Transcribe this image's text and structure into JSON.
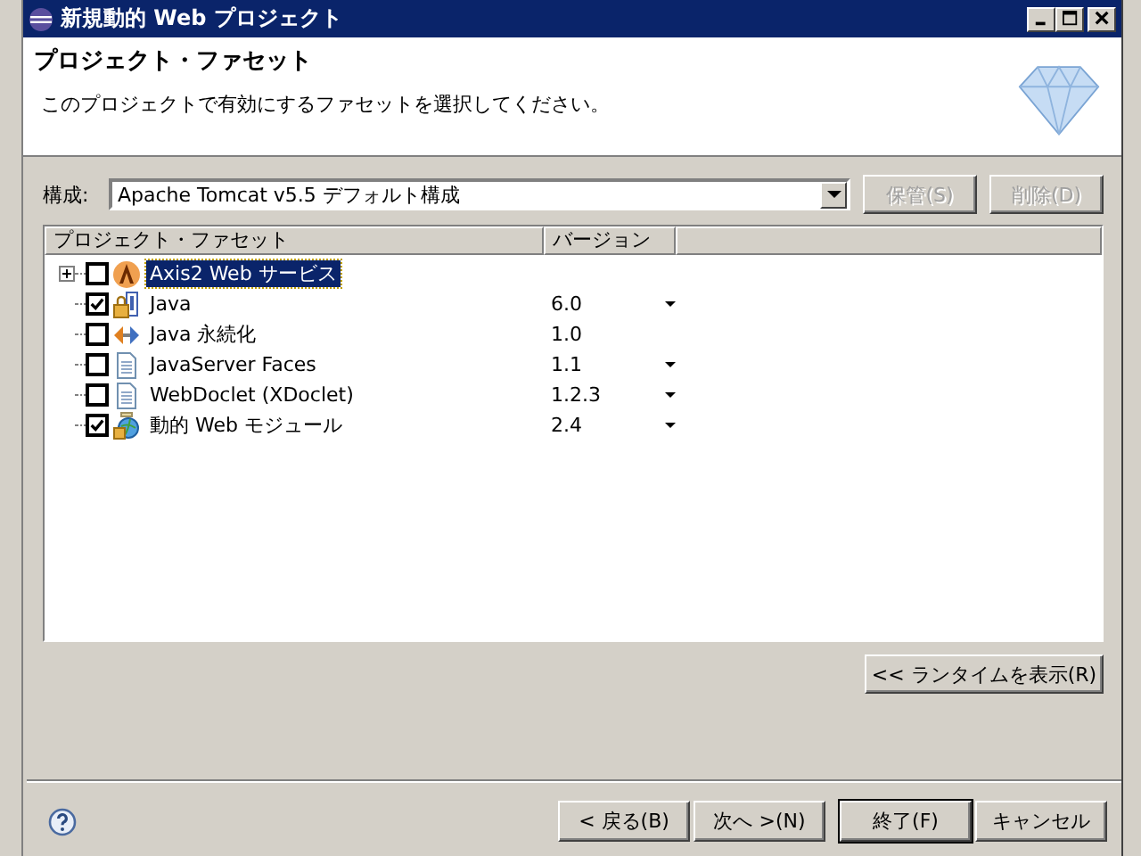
{
  "window": {
    "title": "新規動的 Web プロジェクト"
  },
  "header": {
    "title": "プロジェクト・ファセット",
    "description": "このプロジェクトで有効にするファセットを選択してください。"
  },
  "configuration": {
    "label": "構成:",
    "value": "Apache Tomcat v5.5 デフォルト構成",
    "buttons": [
      {
        "label": "保管(S)",
        "disabled": true
      },
      {
        "label": "削除(D)",
        "disabled": true
      }
    ]
  },
  "table": {
    "columns": [
      "プロジェクト・ファセット",
      "バージョン"
    ],
    "rows": [
      {
        "name": "Axis2 Web サービス",
        "kind": "axis",
        "has_choices": false,
        "checked": false,
        "selected": true,
        "expanded": false
      },
      {
        "name": "Java",
        "kind": "java",
        "version": "6.0",
        "has_choices": true,
        "checked": true,
        "selected": false
      },
      {
        "name": "Java 永続化",
        "kind": "persistence",
        "version": "1.0",
        "has_choices": false,
        "checked": false,
        "selected": false
      },
      {
        "name": "JavaServer Faces",
        "kind": "document",
        "version": "1.1",
        "has_choices": true,
        "checked": false,
        "selected": false
      },
      {
        "name": "WebDoclet (XDoclet)",
        "kind": "document",
        "version": "1.2.3",
        "has_choices": true,
        "checked": false,
        "selected": false
      },
      {
        "name": "動的 Web モジュール",
        "kind": "module",
        "version": "2.4",
        "has_choices": true,
        "checked": true,
        "selected": false
      }
    ]
  },
  "runtime_button": "<< ランタイムを表示(R)",
  "buttons": [
    {
      "label": "< 戻る(B)",
      "default": false
    },
    {
      "label": "次へ >(N)",
      "default": false
    },
    {
      "label": "終了(F)",
      "default": true
    },
    {
      "label": "キャンセル",
      "default": false
    }
  ]
}
